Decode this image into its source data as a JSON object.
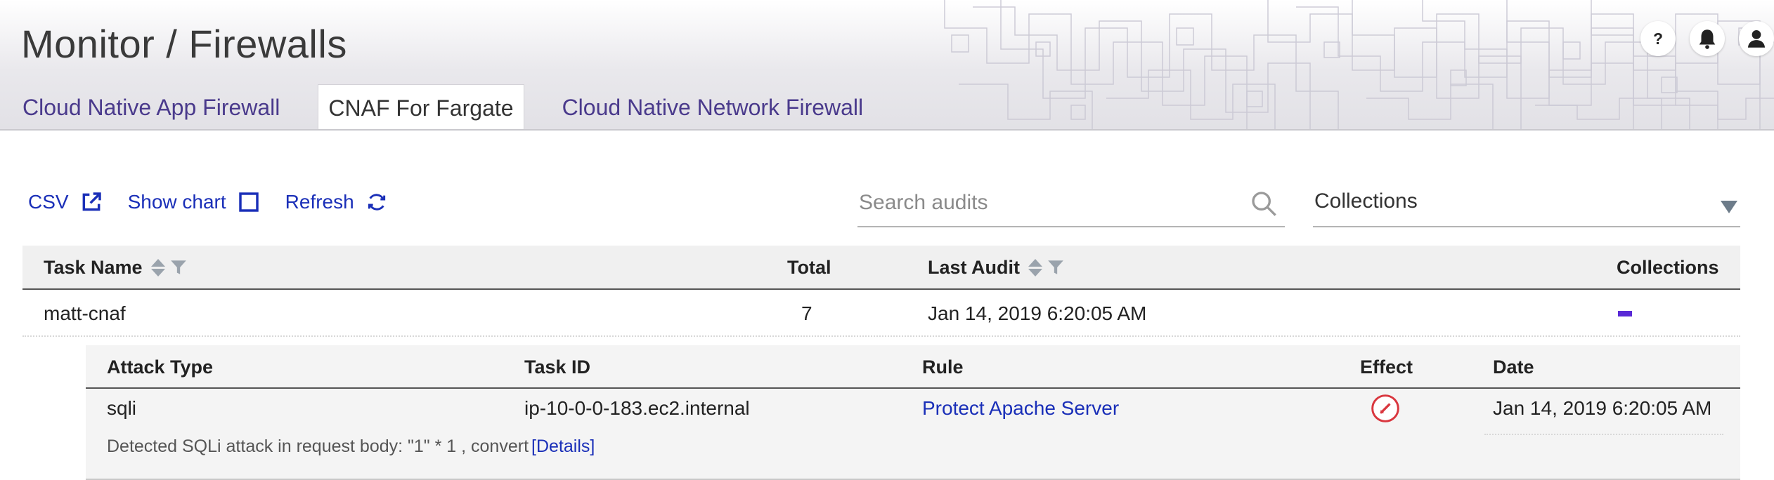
{
  "header": {
    "title": "Monitor / Firewalls",
    "icons": [
      "help-icon",
      "bell-icon",
      "user-icon"
    ]
  },
  "tabs": [
    {
      "label": "Cloud Native App Firewall",
      "active": false
    },
    {
      "label": "CNAF For Fargate",
      "active": true
    },
    {
      "label": "Cloud Native Network Firewall",
      "active": false
    }
  ],
  "toolbar": {
    "csv_label": "CSV",
    "show_chart_label": "Show chart",
    "refresh_label": "Refresh"
  },
  "search": {
    "placeholder": "Search audits",
    "value": ""
  },
  "collections_filter": {
    "label": "Collections"
  },
  "table": {
    "columns": [
      "Task Name",
      "Total",
      "Last Audit",
      "Collections"
    ],
    "rows": [
      {
        "task_name": "matt-cnaf",
        "total": "7",
        "last_audit": "Jan 14, 2019 6:20:05 AM",
        "collections_color": "#5a2ad6"
      }
    ]
  },
  "subtable": {
    "columns": [
      "Attack Type",
      "Task ID",
      "Rule",
      "Effect",
      "Date"
    ],
    "rows": [
      {
        "attack_type": "sqli",
        "task_id": "ip-10-0-0-183.ec2.internal",
        "rule": "Protect Apache Server",
        "effect_icon": "alert-effect-icon",
        "date": "Jan 14, 2019 6:20:05 AM",
        "detail_text": "Detected SQLi attack in request body: \"1\" * 1 , convert",
        "detail_link": "[Details]"
      }
    ]
  },
  "colors": {
    "accent": "#1a2fb8",
    "tab_text": "#4a3a8c",
    "effect": "#d9363e"
  }
}
